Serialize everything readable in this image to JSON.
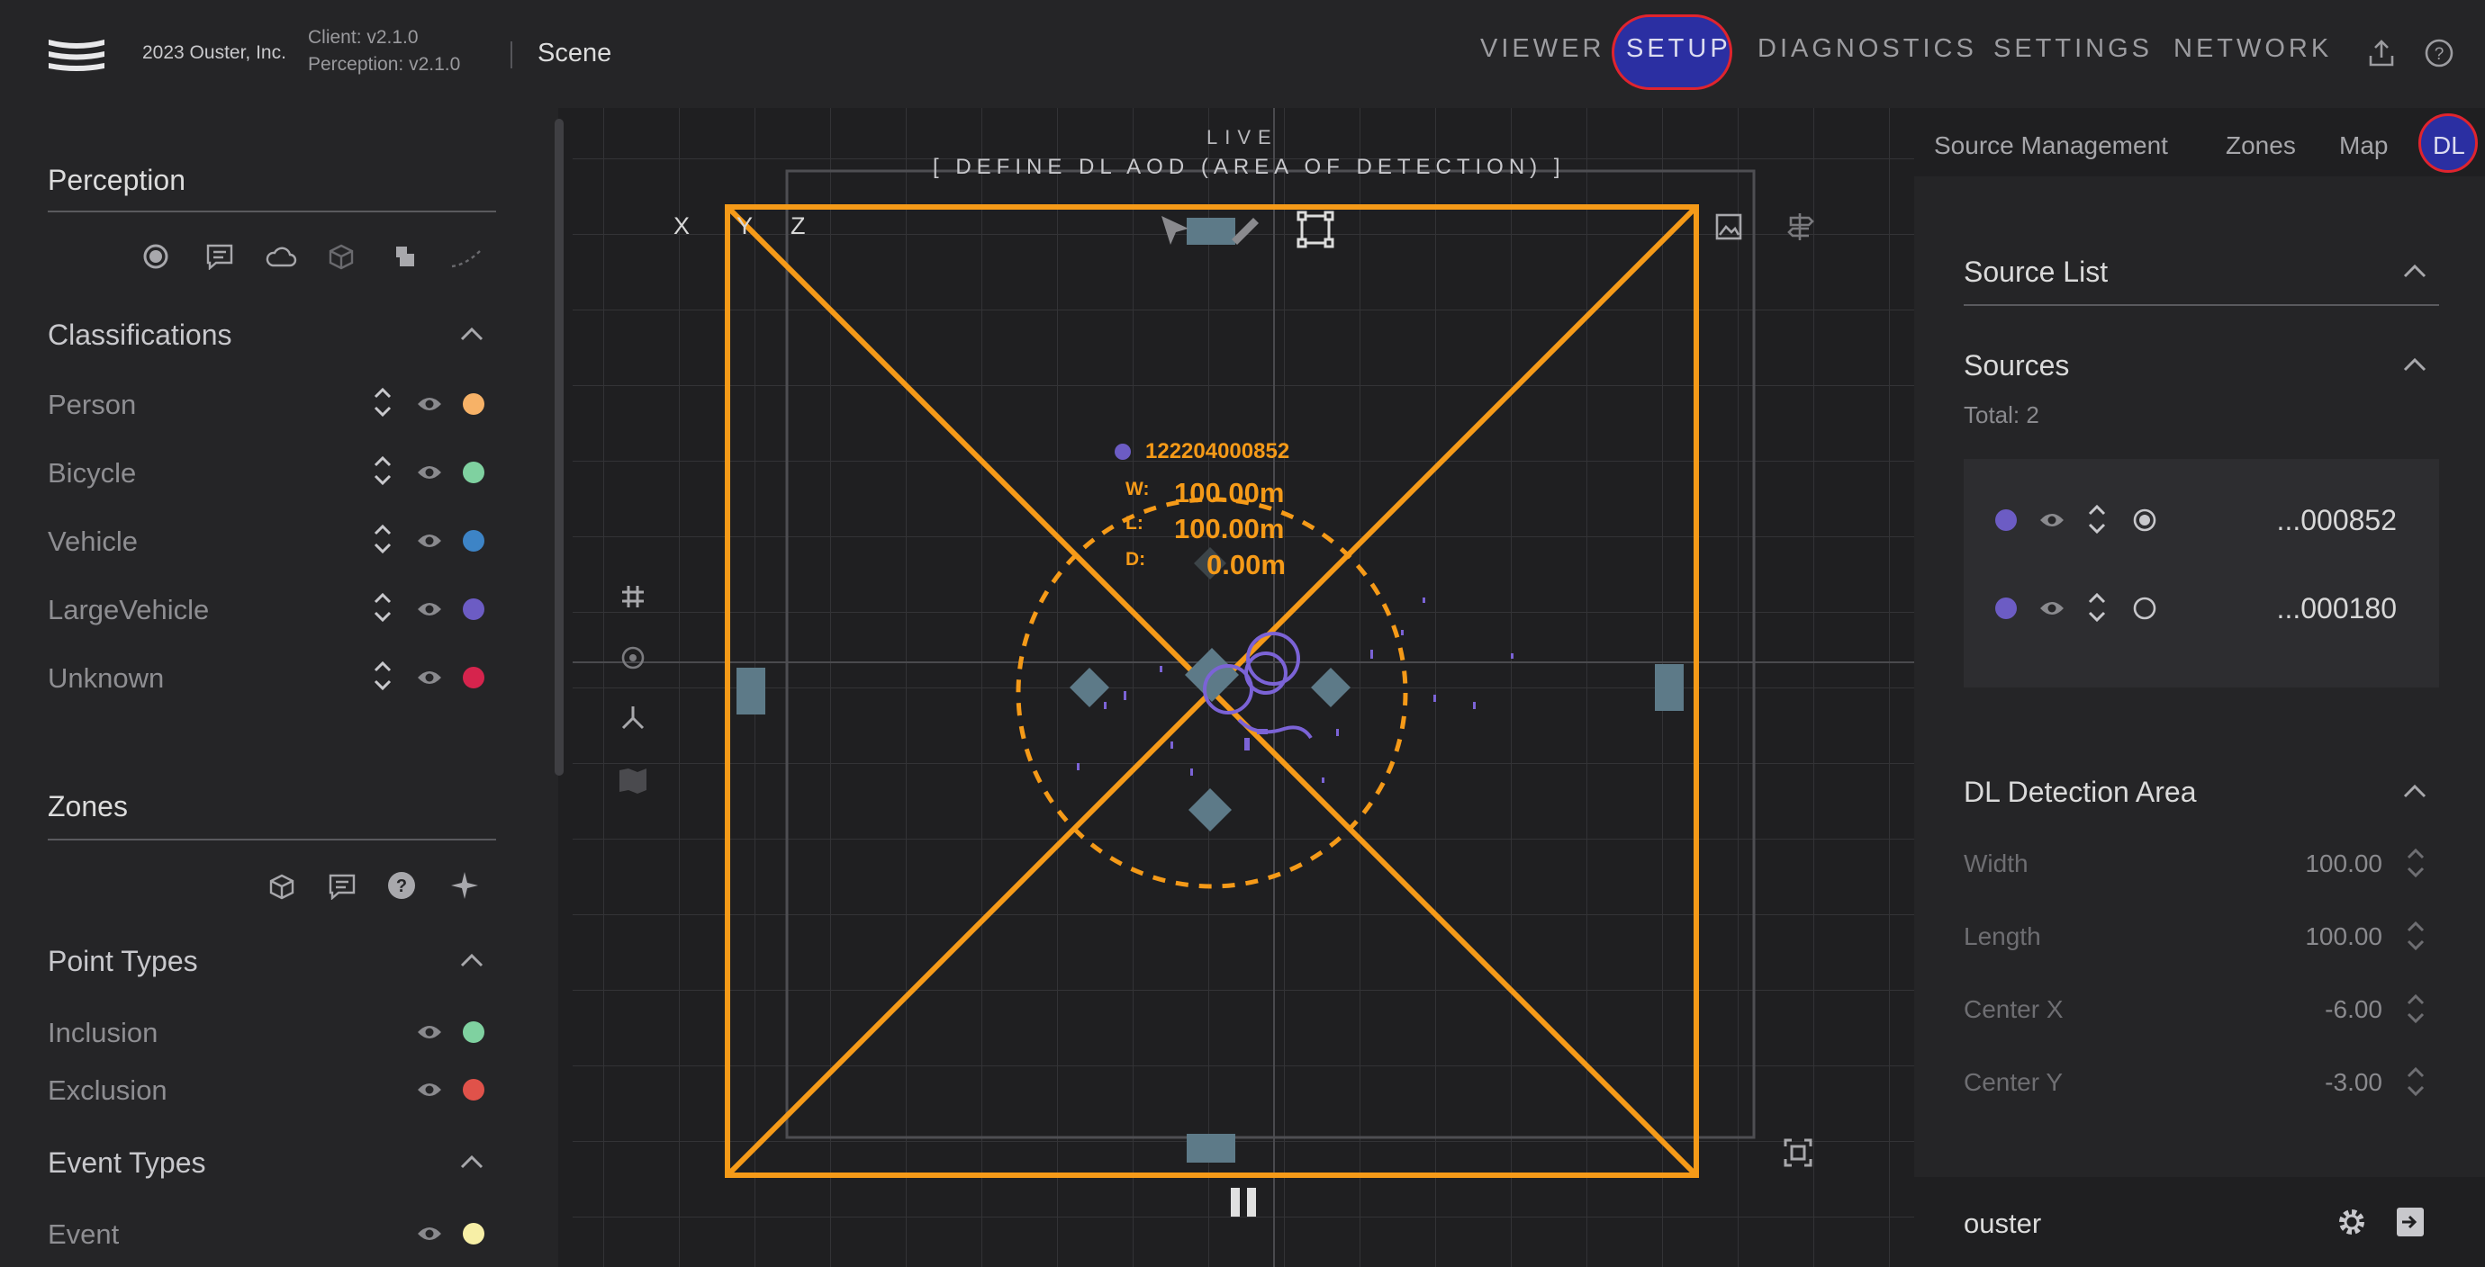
{
  "header": {
    "copyright": "2023 Ouster, Inc.",
    "client_version": "Client: v2.1.0",
    "perception_version": "Perception: v2.1.0",
    "page": "Scene",
    "nav": [
      "VIEWER",
      "SETUP",
      "DIAGNOSTICS",
      "SETTINGS",
      "NETWORK"
    ],
    "active_nav": "SETUP",
    "accent_color": "#2b2fa2",
    "highlight_color": "#e0242e"
  },
  "left": {
    "perception_title": "Perception",
    "classifications_title": "Classifications",
    "classifications": [
      {
        "label": "Person",
        "color": "#f7b267"
      },
      {
        "label": "Bicycle",
        "color": "#7fd1a0"
      },
      {
        "label": "Vehicle",
        "color": "#3d84c6"
      },
      {
        "label": "LargeVehicle",
        "color": "#6c5cc4"
      },
      {
        "label": "Unknown",
        "color": "#d6244d"
      }
    ],
    "zones_title": "Zones",
    "point_types_title": "Point Types",
    "point_types": [
      {
        "label": "Inclusion",
        "color": "#7fd1a0"
      },
      {
        "label": "Exclusion",
        "color": "#e0524a"
      }
    ],
    "event_types_title": "Event Types",
    "event_types": [
      {
        "label": "Event",
        "color": "#f7efa6"
      }
    ]
  },
  "viewer": {
    "live": "LIVE",
    "mode_banner": "[ DEFINE DL AOD (AREA OF DETECTION) ]",
    "axes": [
      "X",
      "Y",
      "Z"
    ],
    "sensor_id": "122204000852",
    "w_label": "W:",
    "w_value": "100.00m",
    "l_label": "L:",
    "l_value": "100.00m",
    "d_label": "D:",
    "d_value": "0.00m",
    "aod_color": "#f59a18",
    "point_color": "#7b63d6"
  },
  "right": {
    "tabs": [
      "Source Management",
      "Zones",
      "Map",
      "DL"
    ],
    "active_tab": "DL",
    "source_list_title": "Source List",
    "sources_title": "Sources",
    "total": "Total: 2",
    "sources": [
      {
        "id": "...000852",
        "selected": true
      },
      {
        "id": "...000180",
        "selected": false
      }
    ],
    "dl_area_title": "DL Detection Area",
    "fields": [
      {
        "label": "Width",
        "value": "100.00"
      },
      {
        "label": "Length",
        "value": "100.00"
      },
      {
        "label": "Center X",
        "value": "-6.00"
      },
      {
        "label": "Center Y",
        "value": "-3.00"
      }
    ],
    "user": "ouster"
  }
}
